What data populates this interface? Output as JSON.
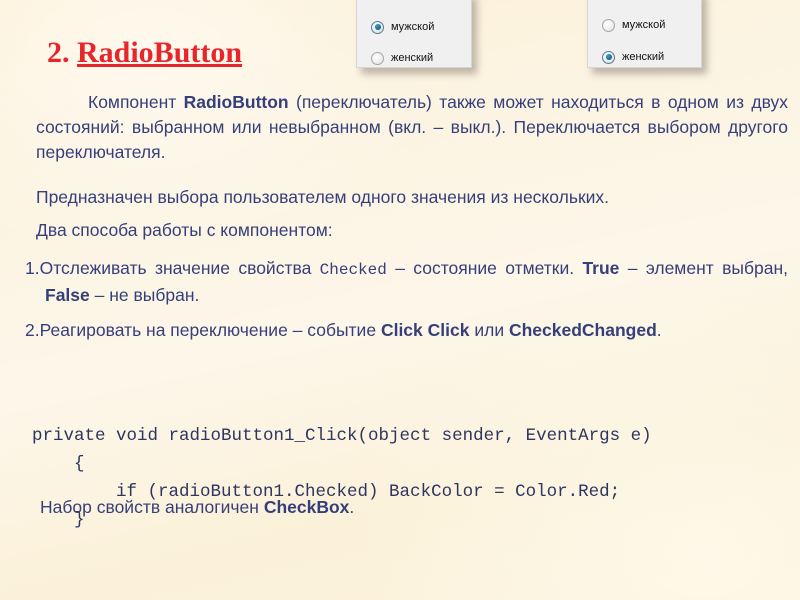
{
  "slide": {
    "background_color": "#fdf3df",
    "title": {
      "number": "2. ",
      "word": "RadioButton",
      "color": "#e8252a"
    }
  },
  "panels": [
    {
      "name": "radio-panel-male-selected",
      "options": [
        {
          "label": "мужской",
          "selected": true
        },
        {
          "label": "женский",
          "selected": false
        }
      ]
    },
    {
      "name": "radio-panel-female-selected",
      "options": [
        {
          "label": "мужской",
          "selected": false
        },
        {
          "label": "женский",
          "selected": true
        }
      ]
    }
  ],
  "body": {
    "paragraph_main": {
      "part1": "Компонент ",
      "bold1": "RadioButton",
      "part2": " (переключатель) также может находиться в одном из двух состояний: выбранном или невыбранном (вкл. – выкл.). Переключается выбором другого переключателя."
    },
    "paragraph_2": "Предназначен выбора пользователем одного значения из нескольких.",
    "paragraph_3": "Два способа работы с компонентом:",
    "list": [
      {
        "number": "1.",
        "part1": "Отслеживать значение свойства ",
        "mono": "Checked",
        "part2": " – состояние отметки. ",
        "bold1": "True",
        "part3": " – элемент выбран, ",
        "bold2": "False",
        "part4": " – не выбран."
      },
      {
        "number": "2.",
        "part1": "Реагировать на переключение – событие ",
        "bold1": "Click Click",
        "part2": " или ",
        "bold2": "CheckedChanged",
        "part3": "."
      }
    ],
    "code": "private void radioButton1_Click(object sender, EventArgs e)\n    {\n        if (radioButton1.Checked) BackColor = Color.Red;\n    }",
    "final_line": {
      "part1": "Набор свойств аналогичен ",
      "bold1": "CheckBox",
      "part2": "."
    }
  }
}
